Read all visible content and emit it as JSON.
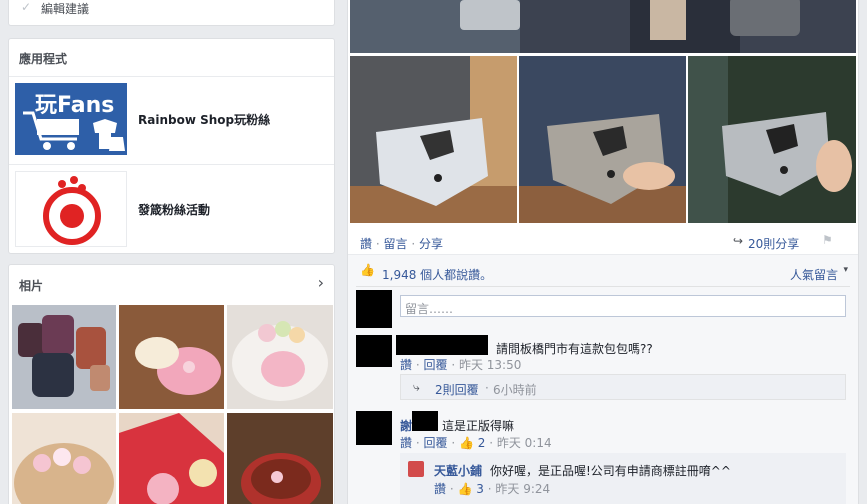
{
  "suggest_edit": "編輯建議",
  "apps": {
    "title": "應用程式",
    "items": [
      {
        "label": "Rainbow Shop玩粉絲",
        "logo_text": "玩Fans"
      },
      {
        "label": "發箴粉絲活動"
      }
    ]
  },
  "photos": {
    "title": "相片"
  },
  "post": {
    "actions": {
      "like": "讚",
      "comment": "留言",
      "share": "分享"
    },
    "share_count": "20則分享",
    "likes_text": "1,948 個人都說讚。",
    "sort_label": "人氣留言",
    "comment_placeholder": "留言……",
    "comments": [
      {
        "text": "請問板橋門市有這款包包嗎??",
        "like": "讚",
        "reply": "回覆",
        "time": "昨天 13:50",
        "replies_link": "2則回覆",
        "replies_time": "6小時前"
      },
      {
        "name_prefix": "謝",
        "text": "這是正版得嘛",
        "like": "讚",
        "reply": "回覆",
        "likes": "2",
        "time": "昨天 0:14",
        "reply_item": {
          "name": "天藍小鋪",
          "text": "你好喔，是正品喔!公司有申請商標註冊唷^^",
          "like": "讚",
          "likes": "3",
          "time": "昨天 9:24"
        }
      }
    ]
  },
  "colors": {
    "link": "#365899",
    "brand_blue": "#2e5fa8",
    "red": "#e02323"
  }
}
